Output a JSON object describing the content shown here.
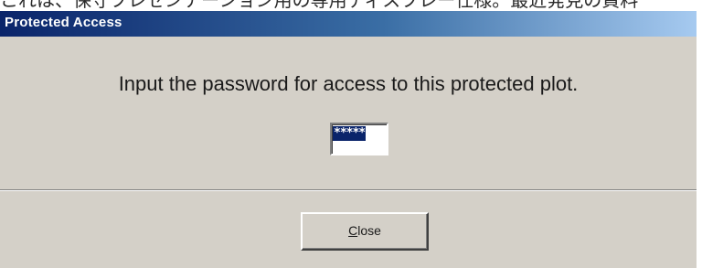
{
  "background_text": "これは、保守プレゼンテーション用の専用ディスプレー仕様。最近発見の資料",
  "dialog": {
    "title": "Protected Access",
    "prompt": "Input the password for access to this protected  plot.",
    "password_field": {
      "value": "*****"
    },
    "close_button": {
      "mnemonic": "C",
      "label_rest": "lose"
    }
  },
  "colors": {
    "titlebar_start": "#0a246a",
    "titlebar_end": "#a6caf0",
    "dialog_face": "#d4d0c8",
    "selection": "#0a246a"
  }
}
